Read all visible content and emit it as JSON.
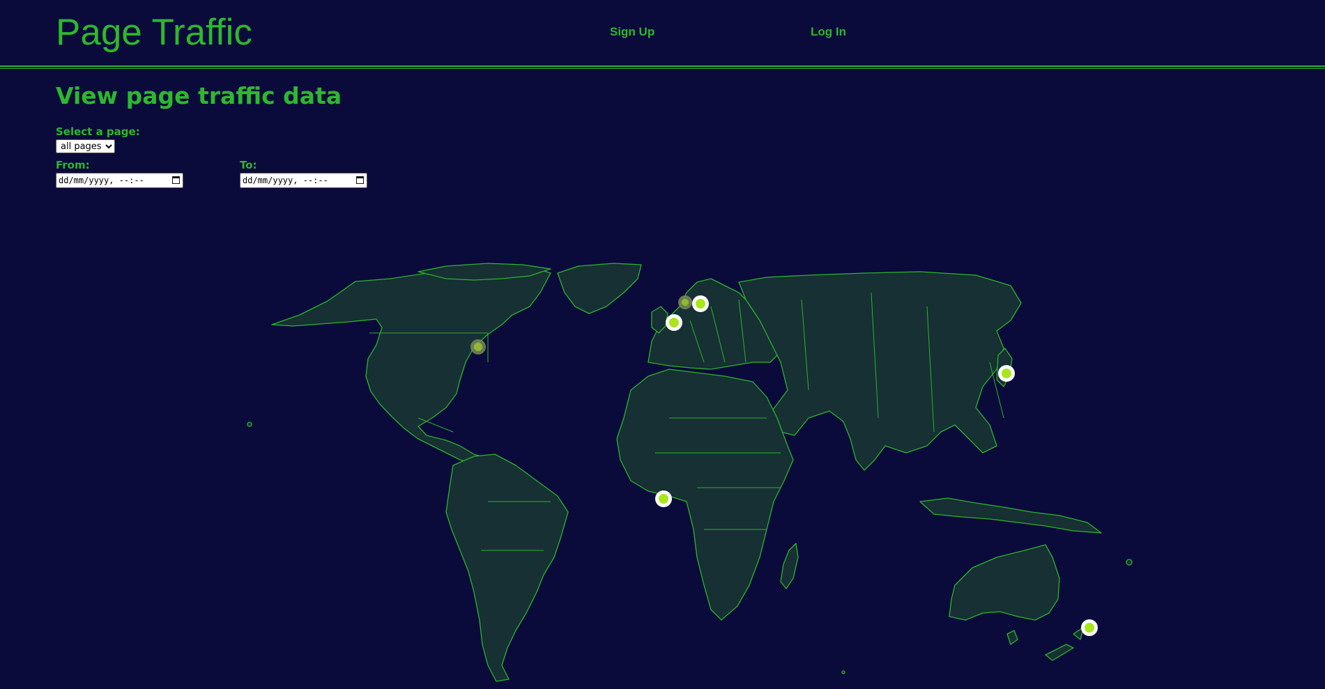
{
  "header": {
    "brand": "Page Traffic",
    "nav": {
      "signup": "Sign Up",
      "login": "Log In"
    }
  },
  "main": {
    "title": "View page traffic data",
    "page_label": "Select a page:",
    "page_select": {
      "selected": "all pages",
      "options": [
        "all pages"
      ]
    },
    "from_label": "From:",
    "to_label": "To:",
    "from_value": "dd/mm/yyyy, --:--",
    "to_value": "dd/mm/yyyy, --:--"
  },
  "colors": {
    "background": "#0b0b3b",
    "accent": "#2db82d",
    "land": "#163033",
    "marker": "#a8e61b"
  }
}
